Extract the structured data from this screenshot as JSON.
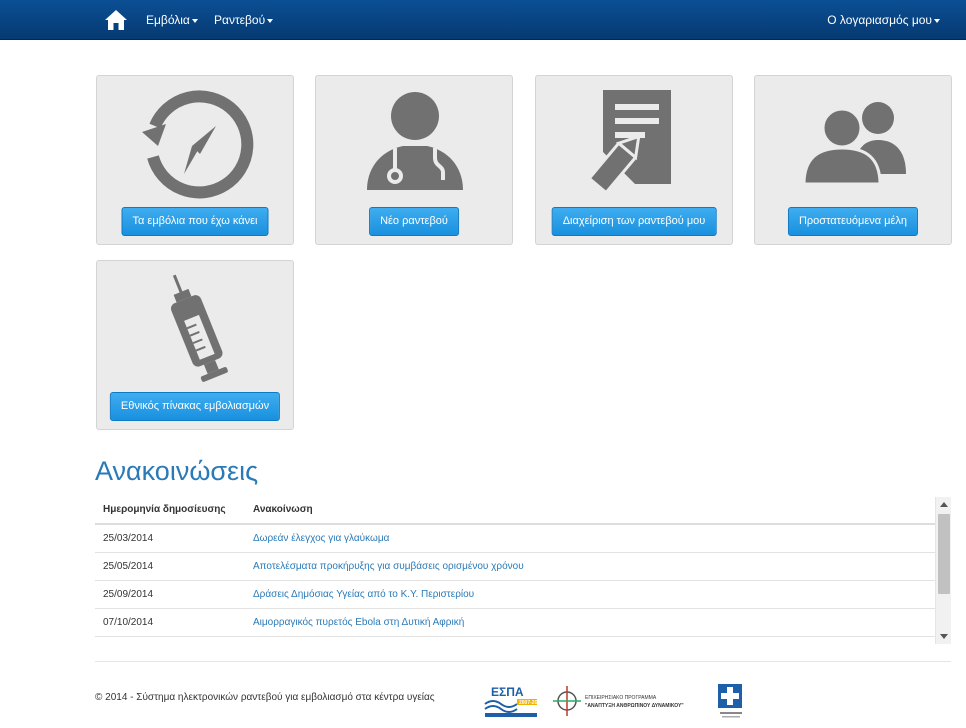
{
  "navbar": {
    "home_icon": "home-icon",
    "menus": [
      {
        "label": "Εμβόλια"
      },
      {
        "label": "Ραντεβού"
      }
    ],
    "account_label": "Ο λογαριασμός μου",
    "background": "#0b4f94"
  },
  "tiles": [
    {
      "icon": "history-clock-icon",
      "button_label": "Τα εμβόλια που έχω κάνει"
    },
    {
      "icon": "doctor-icon",
      "button_label": "Νέο ραντεβού"
    },
    {
      "icon": "document-edit-icon",
      "button_label": "Διαχείριση των ραντεβού μου"
    },
    {
      "icon": "users-icon",
      "button_label": "Προστατευόμενα μέλη"
    },
    {
      "icon": "syringe-icon",
      "button_label": "Εθνικός πίνακας εμβολιασμών"
    }
  ],
  "announcements": {
    "title": "Ανακοινώσεις",
    "columns": [
      "Ημερομηνία δημοσίευσης",
      "Ανακοίνωση"
    ],
    "rows": [
      {
        "date": "25/03/2014",
        "text": "Δωρεάν έλεγχος για γλαύκωμα"
      },
      {
        "date": "25/05/2014",
        "text": "Αποτελέσματα προκήρυξης για συμβάσεις ορισμένου χρόνου"
      },
      {
        "date": "25/09/2014",
        "text": "Δράσεις Δημόσιας Υγείας από το Κ.Υ. Περιστερίου"
      },
      {
        "date": "07/10/2014",
        "text": "Αιμορραγικός πυρετός Ebola στη Δυτική Αφρική"
      }
    ]
  },
  "footer": {
    "copyright": "© 2014 - Σύστημα ηλεκτρονικών ραντεβού για εμβολιασμό στα κέντρα υγείας",
    "logos": [
      {
        "name": "espa-logo",
        "text": "ΕΣΠΑ",
        "subtext": "2007-2013"
      },
      {
        "name": "operational-programme-logo",
        "line1": "ΕΠΙΧΕΙΡΗΣΙΑΚΟ ΠΡΟΓΡΑΜΜΑ",
        "line2": "\"ΑΝΑΠΤΥΞΗ ΑΝΘΡΩΠΙΝΟΥ ΔΥΝΑΜΙΚΟΥ\""
      },
      {
        "name": "ministry-of-health-logo"
      }
    ]
  },
  "colors": {
    "accent": "#2a7ab8",
    "button": "#1990de",
    "tile_bg": "#ebebeb",
    "icon": "#717171"
  }
}
